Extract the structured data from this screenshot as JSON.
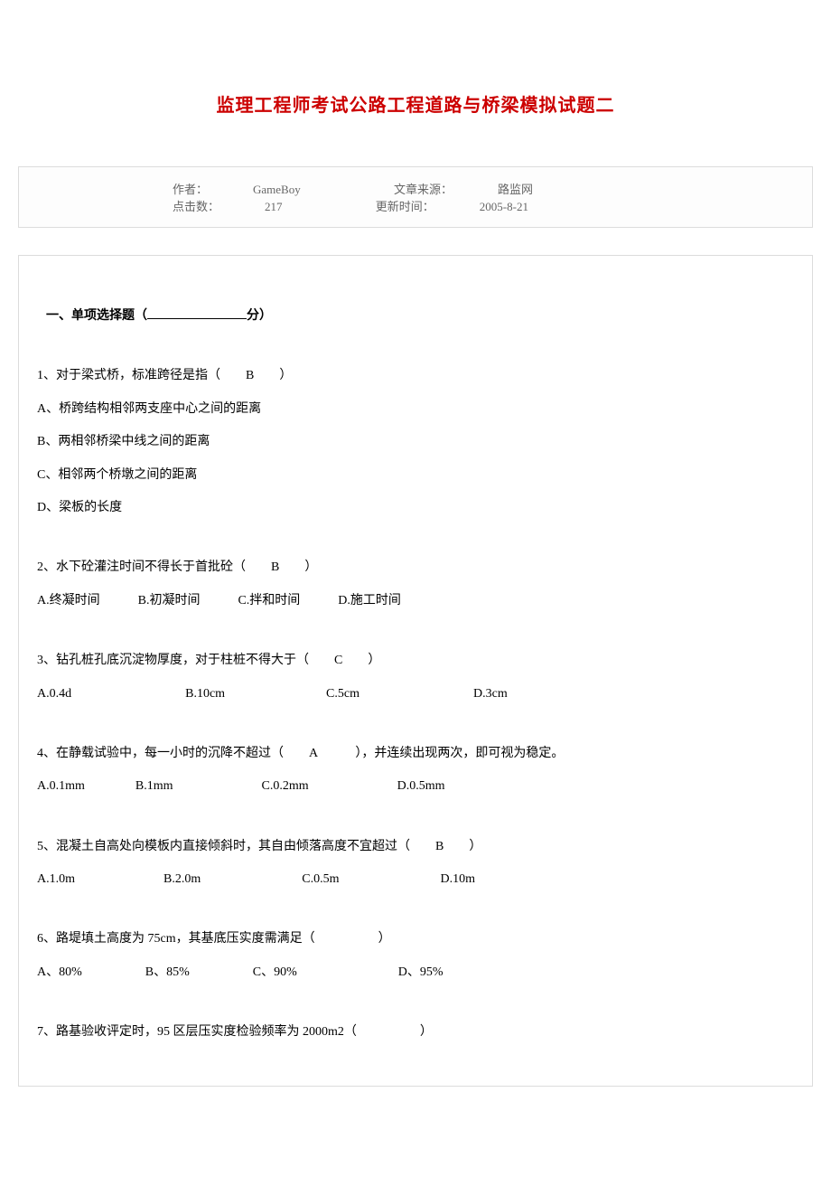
{
  "title": "监理工程师考试公路工程道路与桥梁模拟试题二",
  "meta": {
    "author_label": "作者：",
    "author": "GameBoy",
    "source_label": "文章来源：",
    "source": "路监网",
    "hits_label": "点击数：",
    "hits": "217",
    "update_label": "更新时间：",
    "update": "2005-8-21"
  },
  "section_heading_prefix": "一、单项选择题（",
  "section_heading_suffix": "分）",
  "questions": [
    {
      "stem": "1、对于梁式桥，标准跨径是指（　　B　　）",
      "lines": [
        "A、桥跨结构相邻两支座中心之间的距离",
        "B、两相邻桥梁中线之间的距离",
        "C、相邻两个桥墩之间的距离",
        "D、梁板的长度"
      ]
    },
    {
      "stem": "2、水下砼灌注时间不得长于首批砼（　　B　　）",
      "lines": [
        "A.终凝时间　　　B.初凝时间　　　C.拌和时间　　　D.施工时间"
      ]
    },
    {
      "stem": "3、钻孔桩孔底沉淀物厚度，对于柱桩不得大于（　　C　　）",
      "lines": [
        "A.0.4d　　　　　　　　　B.10cm　　　　　　　　C.5cm　　　　　　　　　D.3cm"
      ]
    },
    {
      "stem": "4、在静载试验中，每一小时的沉降不超过（　　A　　　），并连续出现两次，即可视为稳定。",
      "lines": [
        "A.0.1mm　　　　B.1mm　　　　　　　C.0.2mm　　　　　　　D.0.5mm"
      ]
    },
    {
      "stem": "5、混凝土自高处向模板内直接倾斜时，其自由倾落高度不宜超过（　　B　　）",
      "lines": [
        "A.1.0m　　　　　　　B.2.0m　　　　　　　　C.0.5m　　　　　　　　D.10m"
      ]
    },
    {
      "stem": "6、路堤填土高度为 75cm，其基底压实度需满足（　　　　　）",
      "lines": [
        "A、80%　　　　　B、85%　　　　　C、90%　　　　　　　　D、95%"
      ]
    },
    {
      "stem": "7、路基验收评定时，95 区层压实度检验频率为 2000m2（　　　　　）",
      "lines": []
    }
  ]
}
